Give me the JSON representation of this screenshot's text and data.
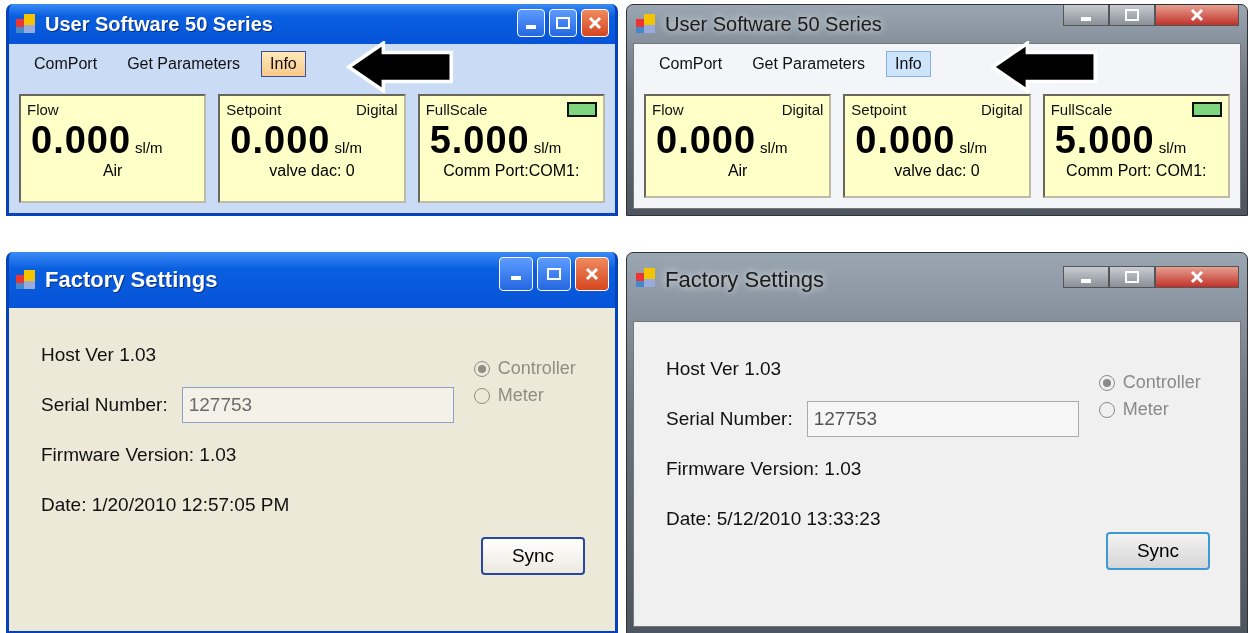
{
  "windows": [
    {
      "kind": "main_xp",
      "title": "User Software 50 Series",
      "menu": [
        {
          "label": "ComPort",
          "selected": false
        },
        {
          "label": "Get Parameters",
          "selected": false
        },
        {
          "label": "Info",
          "selected": true
        }
      ],
      "panels": [
        {
          "label": "Flow",
          "value": "0.000",
          "unit": "sl/m",
          "footer": "Air"
        },
        {
          "label": "Setpoint",
          "mode": "Digital",
          "value": "0.000",
          "unit": "sl/m",
          "footer": "valve dac: 0"
        },
        {
          "label": "FullScale",
          "value": "5.000",
          "unit": "sl/m",
          "footer": "Comm Port:COM1:",
          "color": "#7fd67f"
        }
      ]
    },
    {
      "kind": "main_win7",
      "title": "User Software 50 Series",
      "menu": [
        {
          "label": "ComPort",
          "selected": false
        },
        {
          "label": "Get Parameters",
          "selected": false
        },
        {
          "label": "Info",
          "selected": true
        }
      ],
      "panels": [
        {
          "label": "Flow",
          "mode": "Digital",
          "value": "0.000",
          "unit": "sl/m",
          "footer": "Air"
        },
        {
          "label": "Setpoint",
          "mode": "Digital",
          "value": "0.000",
          "unit": "sl/m",
          "footer": "valve dac: 0"
        },
        {
          "label": "FullScale",
          "value": "5.000",
          "unit": "sl/m",
          "footer": "Comm Port: COM1:",
          "color": "#7fd67f"
        }
      ]
    },
    {
      "kind": "settings_xp",
      "title": "Factory Settings",
      "host_version": "Host Ver 1.03",
      "serial_label": "Serial Number:",
      "serial": {
        "value": "127753",
        "disabled": true
      },
      "firmware": "Firmware Version: 1.03",
      "date": "Date: 1/20/2010 12:57:05 PM",
      "radios": [
        {
          "label": "Controller",
          "selected": true,
          "disabled": true
        },
        {
          "label": "Meter",
          "selected": false,
          "disabled": true
        }
      ],
      "button": "Sync"
    },
    {
      "kind": "settings_win7",
      "title": "Factory Settings",
      "host_version": "Host Ver 1.03",
      "serial_label": "Serial Number:",
      "serial": {
        "value": "127753",
        "disabled": true
      },
      "firmware": "Firmware Version: 1.03",
      "date": "Date: 5/12/2010 13:33:23",
      "radios": [
        {
          "label": "Controller",
          "selected": true,
          "disabled": true
        },
        {
          "label": "Meter",
          "selected": false,
          "disabled": true
        }
      ],
      "button": "Sync"
    }
  ]
}
